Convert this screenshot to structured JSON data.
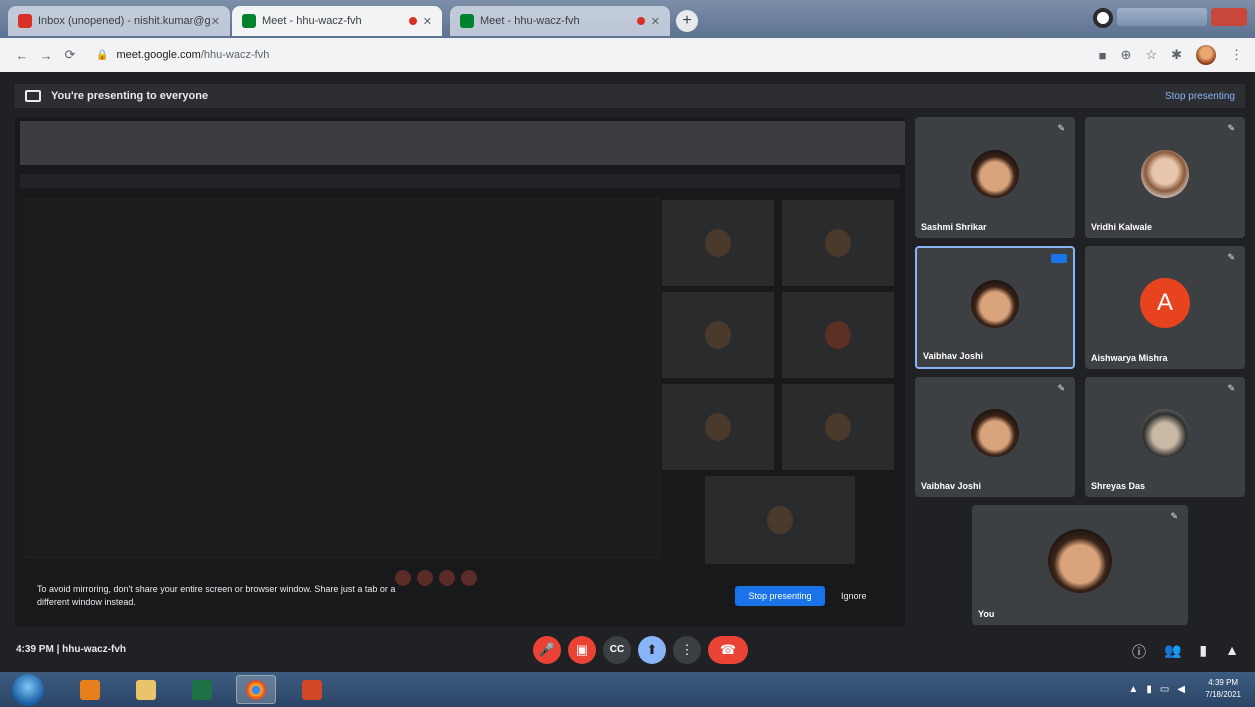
{
  "browser": {
    "tabs": [
      {
        "title": "Inbox (unopened) - nishit.kumar@gmail.com",
        "active": false,
        "recording": false
      },
      {
        "title": "Meet - hhu-wacz-fvh",
        "active": true,
        "recording": true
      },
      {
        "title": "Meet - hhu-wacz-fvh",
        "active": false,
        "recording": true
      }
    ],
    "new_tab": "+",
    "url_host": "meet.google.com",
    "url_path": "/hhu-wacz-fvh"
  },
  "banner": {
    "text": "You're presenting to everyone",
    "stop_label": "Stop presenting"
  },
  "stage": {
    "caption": "To avoid mirroring, don't share your entire screen or browser window. Share just a tab or a different window instead.",
    "stop_button": "Stop presenting",
    "dismiss": "Ignore"
  },
  "participants": [
    {
      "name": "Sashmi Shrikar",
      "avatar": "photo"
    },
    {
      "name": "Vridhi Kalwale",
      "avatar": "photo-light"
    },
    {
      "name": "Vaibhav Joshi",
      "avatar": "photo",
      "speaking": true
    },
    {
      "name": "Aishwarya Mishra",
      "avatar": "letter",
      "letter": "A"
    },
    {
      "name": "Vaibhav Joshi",
      "avatar": "photo"
    },
    {
      "name": "Shreyas Das",
      "avatar": "photo-grey"
    },
    {
      "name": "You",
      "avatar": "photo"
    }
  ],
  "callbar": {
    "time": "4:39 PM",
    "meeting_code": "hhu-wacz-fvh",
    "controls": {
      "mic": "mic-off-icon",
      "camera": "camera-off-icon",
      "captions": "CC",
      "present": "present-icon",
      "more": "more-vert-icon",
      "end": "end-call-icon"
    }
  },
  "taskbar": {
    "clock_time": "4:39 PM",
    "clock_date": "7/18/2021"
  },
  "colors": {
    "meet_background": "#202124",
    "tile_background": "#3c4043",
    "end_call_red": "#ea4335",
    "accent_blue": "#8ab4f8",
    "avatar_orange": "#e8431f"
  }
}
